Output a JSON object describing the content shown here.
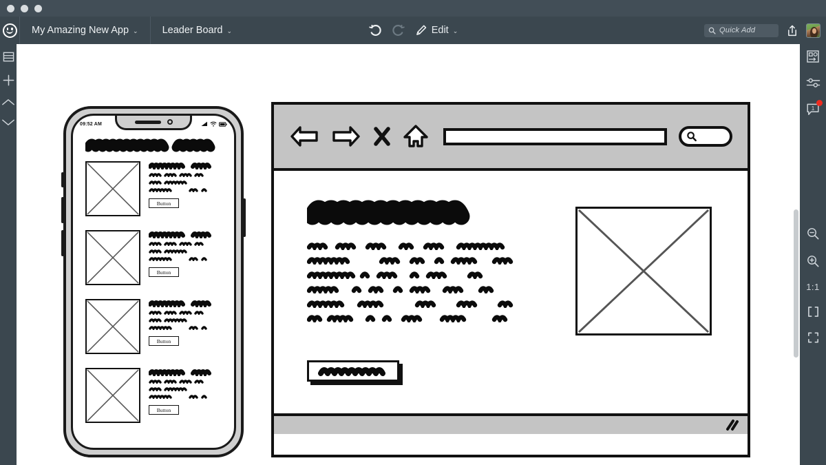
{
  "window": {
    "title_dots": [
      "close",
      "minimize",
      "maximize"
    ],
    "background_color": "#3b474f",
    "accent_color": "#ef2b1f"
  },
  "menubar": {
    "logo_icon": "smiley-face-logo",
    "project_name": "My Amazing New App",
    "page_name": "Leader Board",
    "undo_icon": "undo-arrow-icon",
    "redo_icon": "redo-arrow-icon",
    "edit_icon": "pencil-icon",
    "edit_label": "Edit",
    "caret": "⌄",
    "search": {
      "icon": "search-icon",
      "placeholder": "Quick Add"
    },
    "share_icon": "share-upload-icon",
    "avatar_icon": "user-avatar"
  },
  "left_rail": {
    "items": [
      {
        "icon": "layers-list-icon",
        "label": "Layers"
      },
      {
        "icon": "plus-icon",
        "label": "Add"
      },
      {
        "icon": "chevron-up-icon",
        "label": "Previous"
      },
      {
        "icon": "chevron-down-icon",
        "label": "Next"
      }
    ]
  },
  "right_rail": {
    "top_items": [
      {
        "icon": "link-image-icon",
        "label": "Links"
      },
      {
        "icon": "sliders-settings-icon",
        "label": "Properties"
      },
      {
        "icon": "comment-bubble-icon",
        "label": "Comments",
        "count": "1",
        "has_notification": true
      }
    ],
    "bottom_items": [
      {
        "icon": "zoom-out-icon",
        "label": "Zoom out"
      },
      {
        "icon": "zoom-in-icon",
        "label": "Zoom in"
      },
      {
        "icon": "actual-size-icon",
        "label": "1:1"
      },
      {
        "icon": "fit-width-icon",
        "label": "Fit width"
      },
      {
        "icon": "fit-screen-icon",
        "label": "Fit screen"
      }
    ],
    "zoom_ratio_label": "1:1",
    "fit_width_label": "[ ]",
    "fit_screen_label": "⌞⌝"
  },
  "canvas": {
    "background_color": "#ffffff",
    "scrollbar": {
      "visible": true
    }
  },
  "phone_mock": {
    "name": "mobile-wireframe",
    "status_bar": {
      "time": "09:52 AM",
      "icons": [
        "cellular-signal-icon",
        "wifi-icon",
        "battery-icon"
      ]
    },
    "title_placeholder": "scribble-heading",
    "rows": [
      {
        "image": "image-placeholder",
        "title": "scribble-title",
        "lines": 3,
        "button_label": "Button"
      },
      {
        "image": "image-placeholder",
        "title": "scribble-title",
        "lines": 3,
        "button_label": "Button"
      },
      {
        "image": "image-placeholder",
        "title": "scribble-title",
        "lines": 3,
        "button_label": "Button"
      },
      {
        "image": "image-placeholder",
        "title": "scribble-title",
        "lines": 3,
        "button_label": "Button"
      }
    ]
  },
  "browser_mock": {
    "name": "browser-wireframe",
    "chrome_color": "#c4c4c4",
    "toolbar_icons": [
      {
        "icon": "back-arrow-icon",
        "label": "Back"
      },
      {
        "icon": "forward-arrow-icon",
        "label": "Forward"
      },
      {
        "icon": "close-x-icon",
        "label": "Stop"
      },
      {
        "icon": "home-icon",
        "label": "Home"
      }
    ],
    "address_bar": {
      "value": "",
      "placeholder": ""
    },
    "search_pill": {
      "icon": "search-icon",
      "value": ""
    },
    "content": {
      "heading": "scribble-heading",
      "body_lines": 6,
      "image": "image-placeholder",
      "cta_button": "scribble-button-label"
    },
    "status_bar": {
      "resize_grip": "resize-grip-icon"
    }
  }
}
